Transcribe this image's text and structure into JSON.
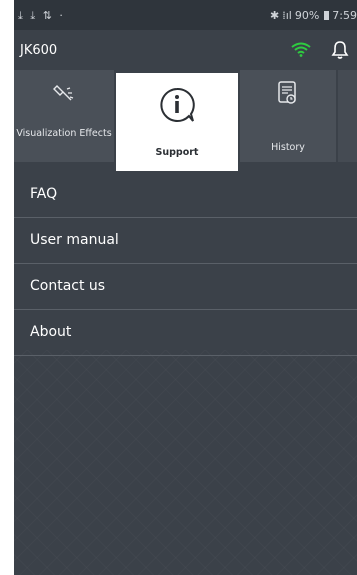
{
  "statusbar": {
    "left_icons": "⤓ ⤓ ⇅ ·",
    "battery": "90%",
    "time": "7:59"
  },
  "app": {
    "title": "JK600"
  },
  "tabs": [
    {
      "label": "Visualization Effects",
      "icon": "sparkle-wand-icon"
    },
    {
      "label": "Support",
      "icon": "info-bubble-icon",
      "active": true
    },
    {
      "label": "History",
      "icon": "history-document-icon"
    }
  ],
  "menu": [
    {
      "label": "FAQ"
    },
    {
      "label": "User manual"
    },
    {
      "label": "Contact us"
    },
    {
      "label": "About"
    }
  ],
  "colors": {
    "background": "#3b4149",
    "wifi_accent": "#2ecc40",
    "active_tab": "#ffffff"
  }
}
